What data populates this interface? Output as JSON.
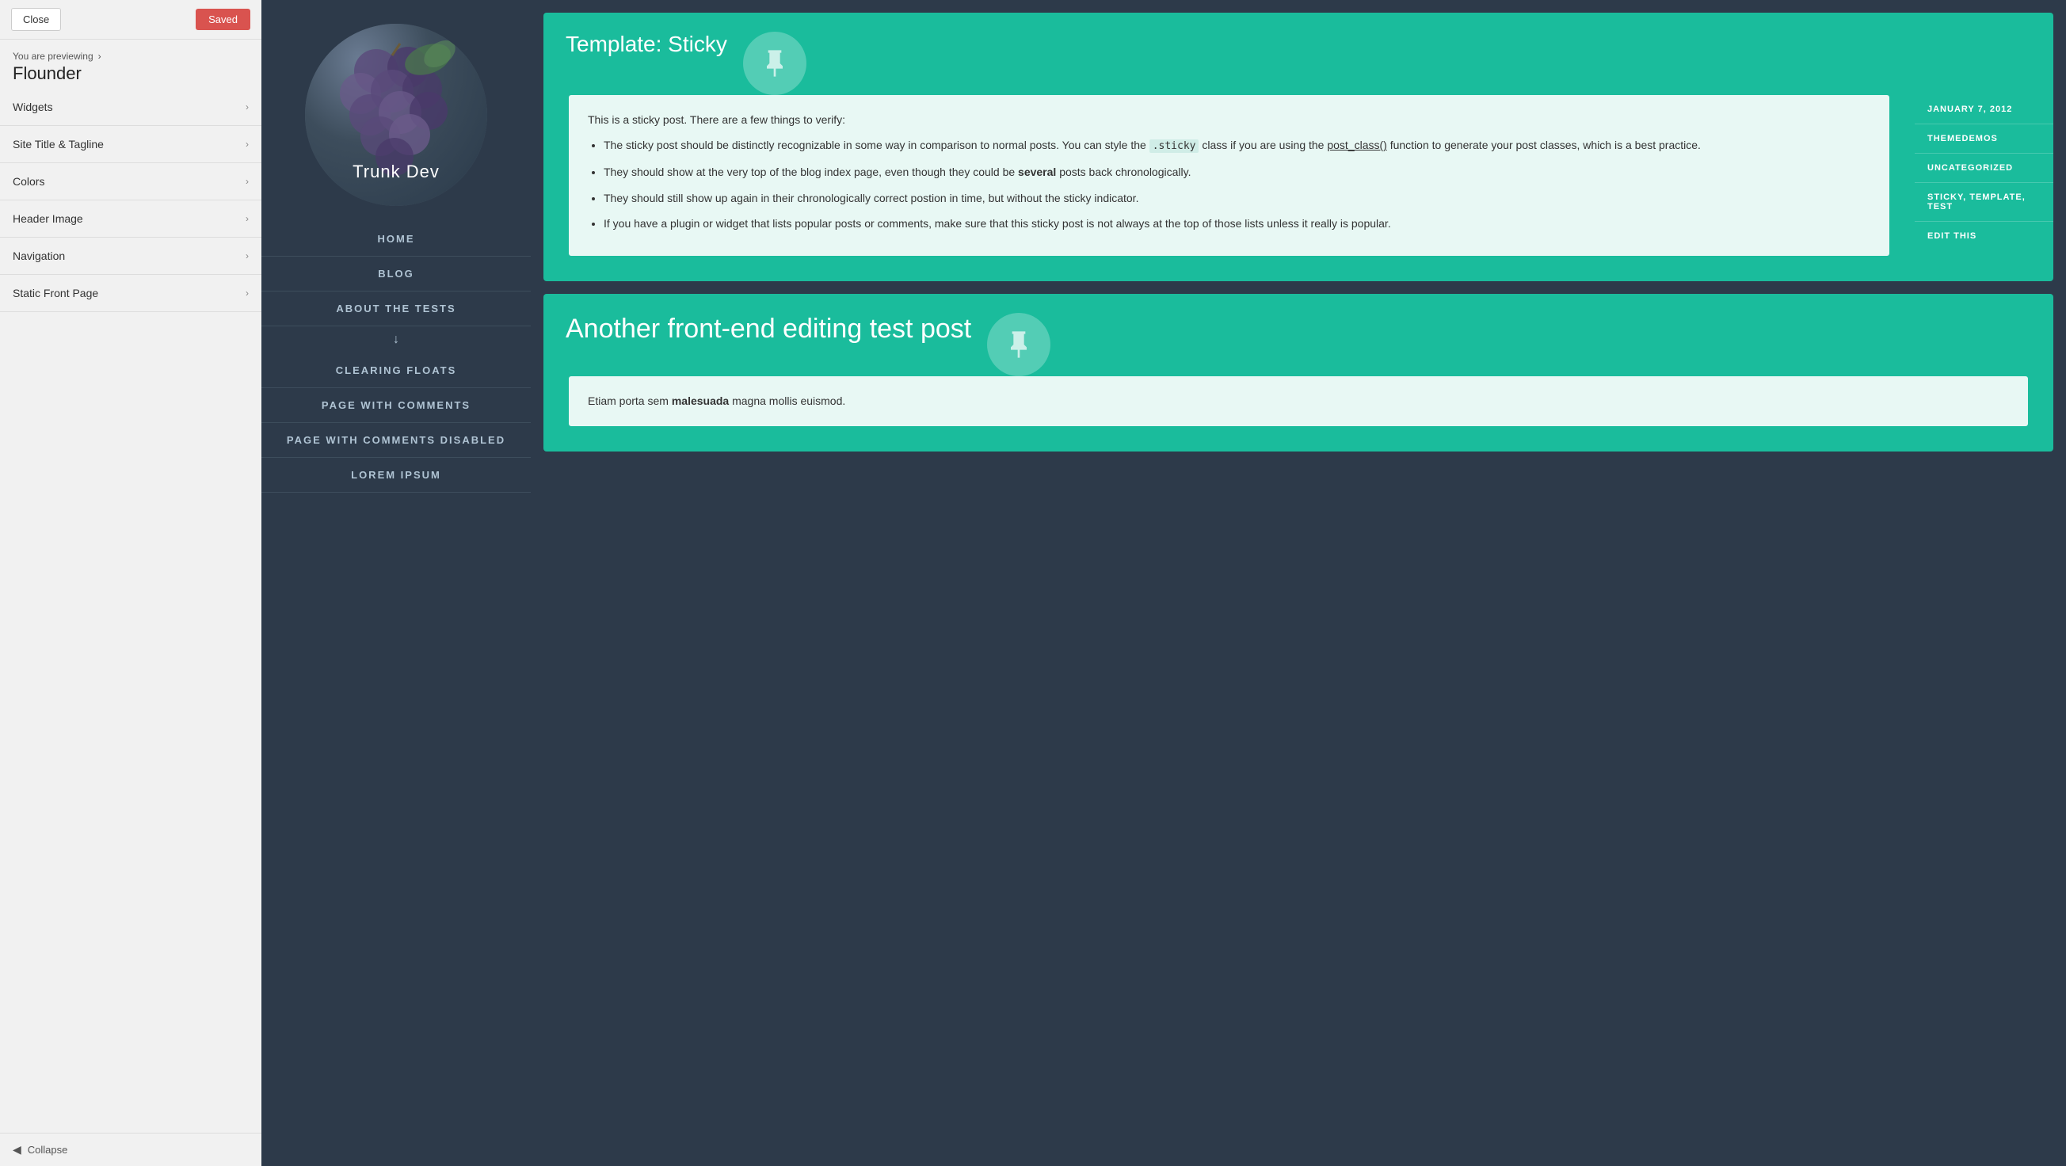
{
  "leftPanel": {
    "closeLabel": "Close",
    "savedLabel": "Saved",
    "previewingLabel": "You are previewing",
    "previewingArrow": "›",
    "siteName": "Flounder",
    "menuItems": [
      {
        "id": "widgets",
        "label": "Widgets"
      },
      {
        "id": "site-title-tagline",
        "label": "Site Title & Tagline"
      },
      {
        "id": "colors",
        "label": "Colors"
      },
      {
        "id": "header-image",
        "label": "Header Image"
      },
      {
        "id": "navigation",
        "label": "Navigation"
      },
      {
        "id": "static-front-page",
        "label": "Static Front Page"
      }
    ],
    "collapseLabel": "Collapse"
  },
  "preview": {
    "siteTitle": "Trunk Dev",
    "navItems": [
      {
        "label": "HOME"
      },
      {
        "label": "BLOG"
      },
      {
        "label": "ABOUT THE TESTS"
      },
      {
        "label": "CLEARING FLOATS"
      },
      {
        "label": "PAGE WITH COMMENTS"
      },
      {
        "label": "PAGE WITH COMMENTS DISABLED"
      },
      {
        "label": "LOREM IPSUM"
      }
    ],
    "hasSubmenu": true,
    "submenuArrow": "↓"
  },
  "posts": [
    {
      "id": "sticky",
      "title": "Template: Sticky",
      "pinIcon": true,
      "intro": "This is a sticky post. There are a few things to verify:",
      "bullets": [
        "The sticky post should be distinctly recognizable in some way in comparison to normal posts. You can style the .sticky class if you are using the post_class() function to generate your post classes, which is a best practice.",
        "They should show at the very top of the blog index page, even though they could be several posts back chronologically.",
        "They should still show up again in their chronologically correct postion in time, but without the sticky indicator.",
        "If you have a plugin or widget that lists popular posts or comments, make sure that this sticky post is not always at the top of those lists unless it really is popular."
      ],
      "meta": {
        "date": "JANUARY 7, 2012",
        "author": "THEMEDEMOS",
        "category": "UNCATEGORIZED",
        "tags": "STICKY, TEMPLATE, TEST",
        "editLabel": "EDIT THIS"
      }
    },
    {
      "id": "front-end-edit",
      "title": "Another front-end editing test post",
      "pinIcon": true,
      "body": "Etiam porta sem malesuada magna mollis euismod.",
      "bodyBold": "malesuada"
    }
  ],
  "icons": {
    "chevronRight": "›",
    "chevronLeft": "‹",
    "circleLeft": "◀"
  }
}
